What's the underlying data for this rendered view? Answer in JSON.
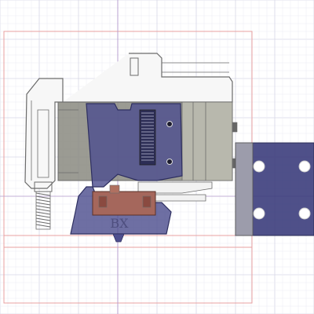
{
  "viewport": {
    "background": "#ffffff",
    "grid_minor_color": "#ebebf3",
    "grid_major_color": "#d7d7e6"
  },
  "sketch": {
    "frame_color": "#e8a0a0",
    "axis_color": "#b8a0d0"
  },
  "model": {
    "outline_color": "#6b6b6b",
    "housing_color": "#f7f7f7",
    "plate_color": "#8a8a80",
    "bracket_color": "#4e4f8f",
    "heater_color": "#a5675c",
    "engraving": "BX"
  },
  "icons": [
    "cad-grid-icon",
    "sketch-frame-icon",
    "extruder-body-icon",
    "mount-plate-icon",
    "hotend-heater-block-icon",
    "nozzle-icon",
    "thermistor-spring-icon"
  ]
}
